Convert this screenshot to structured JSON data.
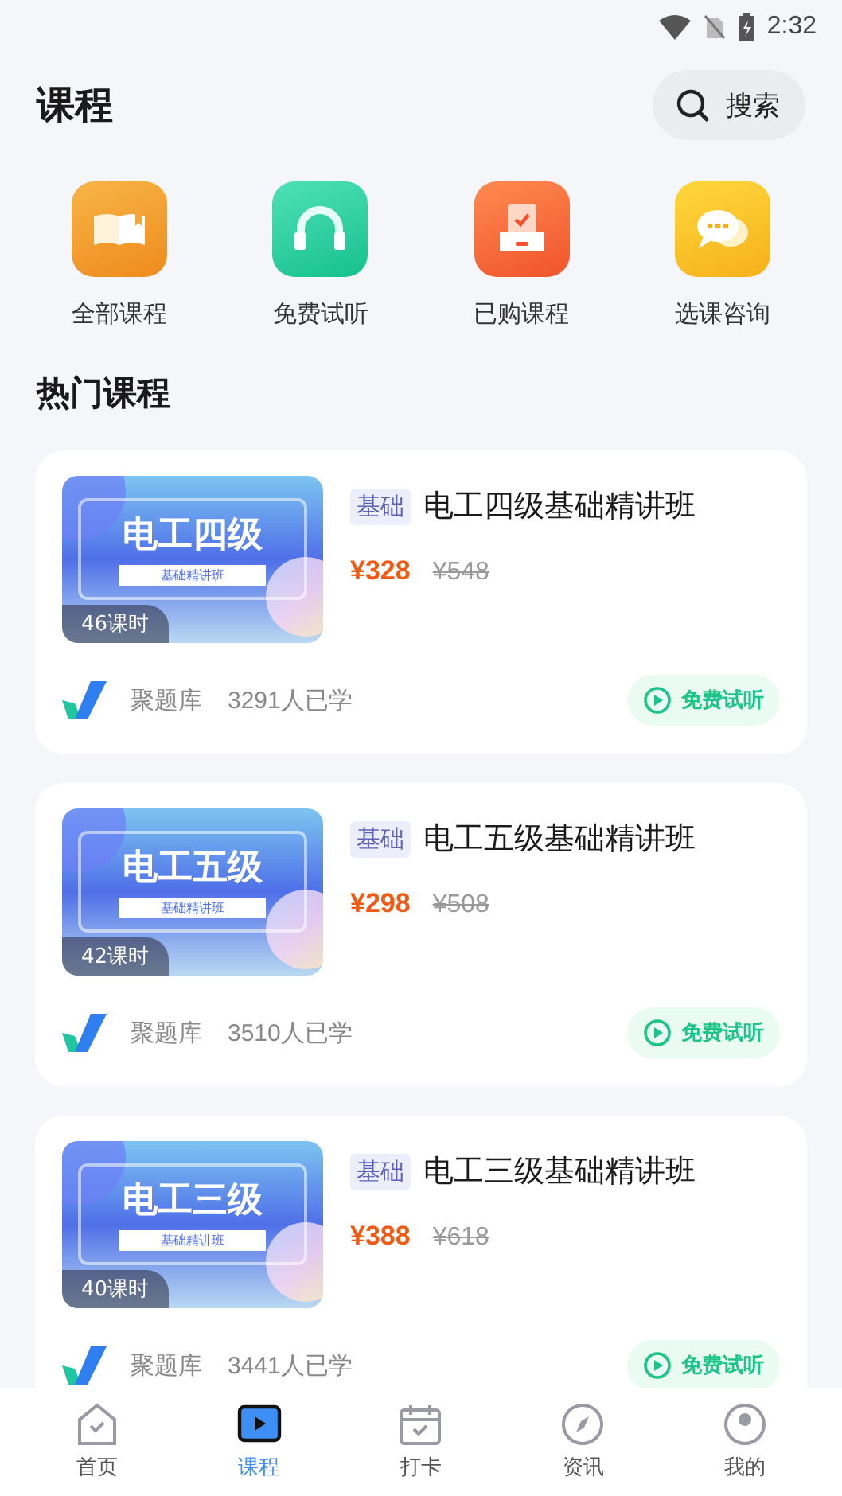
{
  "status_bar": {
    "time": "2:32"
  },
  "header": {
    "title": "课程",
    "search": {
      "label": "搜索"
    }
  },
  "shortcuts": [
    {
      "label": "全部课程",
      "kind": "book"
    },
    {
      "label": "免费试听",
      "kind": "headphones"
    },
    {
      "label": "已购课程",
      "kind": "purchased"
    },
    {
      "label": "选课咨询",
      "kind": "chat"
    }
  ],
  "section_title": "热门课程",
  "courses": [
    {
      "cover_title": "电工四级",
      "cover_subtitle": "基础精讲班",
      "lessons": "46课时",
      "tag": "基础",
      "title": "电工四级基础精讲班",
      "price": "¥328",
      "original_price": "¥548",
      "provider": "聚题库",
      "learners": "3291人已学",
      "trial": "免费试听"
    },
    {
      "cover_title": "电工五级",
      "cover_subtitle": "基础精讲班",
      "lessons": "42课时",
      "tag": "基础",
      "title": "电工五级基础精讲班",
      "price": "¥298",
      "original_price": "¥508",
      "provider": "聚题库",
      "learners": "3510人已学",
      "trial": "免费试听"
    },
    {
      "cover_title": "电工三级",
      "cover_subtitle": "基础精讲班",
      "lessons": "40课时",
      "tag": "基础",
      "title": "电工三级基础精讲班",
      "price": "¥388",
      "original_price": "¥618",
      "provider": "聚题库",
      "learners": "3441人已学",
      "trial": "免费试听"
    }
  ],
  "nav": [
    {
      "label": "首页",
      "kind": "home",
      "selected": false
    },
    {
      "label": "课程",
      "kind": "course",
      "selected": true
    },
    {
      "label": "打卡",
      "kind": "calendar",
      "selected": false
    },
    {
      "label": "资讯",
      "kind": "news",
      "selected": false
    },
    {
      "label": "我的",
      "kind": "profile",
      "selected": false
    }
  ]
}
